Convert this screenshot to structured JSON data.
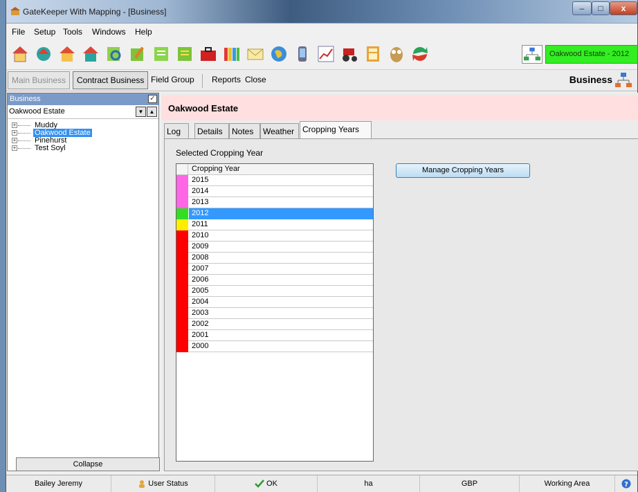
{
  "window": {
    "title": "GateKeeper With Mapping - [Business]",
    "min": "–",
    "max": "□",
    "close": "x"
  },
  "menu": [
    "File",
    "Setup",
    "Tools",
    "Windows",
    "Help"
  ],
  "toolbar": {
    "icons": [
      "home-icon",
      "refresh-home-icon",
      "folder-home-icon",
      "house-arrow-icon",
      "search-doc-icon",
      "edit-doc-icon",
      "notes-icon",
      "tasks-icon",
      "red-case-icon",
      "chart-icon",
      "mail-icon",
      "globe-icon",
      "phone-icon",
      "graph-icon",
      "tractor-icon",
      "calculator-icon",
      "owl-icon",
      "sync-icon"
    ],
    "current_estate": "Oakwood Estate - 2012"
  },
  "nav": {
    "main_business": "Main Business",
    "contract_business": "Contract Business",
    "field_group": "Field Group",
    "reports": "Reports",
    "close": "Close",
    "section_title": "Business"
  },
  "left_panel": {
    "header": "Business",
    "check": "✓",
    "selected_business": "Oakwood Estate",
    "tree": [
      {
        "label": "Muddy",
        "selected": false
      },
      {
        "label": "Oakwood Estate",
        "selected": true
      },
      {
        "label": "Pinehurst",
        "selected": false
      },
      {
        "label": "Test Soyl",
        "selected": false
      }
    ],
    "collapse": "Collapse"
  },
  "content": {
    "title": "Oakwood Estate",
    "tabs": [
      {
        "label": "Log",
        "active": false
      },
      {
        "label": "Details",
        "active": false
      },
      {
        "label": "Notes",
        "active": false
      },
      {
        "label": "Weather",
        "active": false
      },
      {
        "label": "Cropping Years",
        "active": true
      }
    ],
    "selected_label": "Selected Cropping Year",
    "grid_header": "Cropping Year",
    "manage_button": "Manage Cropping Years",
    "years": [
      {
        "year": "2015",
        "color": "#ff66e6"
      },
      {
        "year": "2014",
        "color": "#ff66e6"
      },
      {
        "year": "2013",
        "color": "#ff66e6"
      },
      {
        "year": "2012",
        "color": "#33dd22",
        "selected": true
      },
      {
        "year": "2011",
        "color": "#ffee00"
      },
      {
        "year": "2010",
        "color": "#ff0000"
      },
      {
        "year": "2009",
        "color": "#ff0000"
      },
      {
        "year": "2008",
        "color": "#ff0000"
      },
      {
        "year": "2007",
        "color": "#ff0000"
      },
      {
        "year": "2006",
        "color": "#ff0000"
      },
      {
        "year": "2005",
        "color": "#ff0000"
      },
      {
        "year": "2004",
        "color": "#ff0000"
      },
      {
        "year": "2003",
        "color": "#ff0000"
      },
      {
        "year": "2002",
        "color": "#ff0000"
      },
      {
        "year": "2001",
        "color": "#ff0000"
      },
      {
        "year": "2000",
        "color": "#ff0000"
      }
    ]
  },
  "status": {
    "user": "Bailey Jeremy",
    "user_status": "User Status",
    "ok": "OK",
    "unit": "ha",
    "currency": "GBP",
    "working_area": "Working Area",
    "help": "?"
  },
  "colors": {
    "estate_green": "#33ee22",
    "header_pink": "#ffdfdf",
    "select_blue": "#3399ff"
  }
}
